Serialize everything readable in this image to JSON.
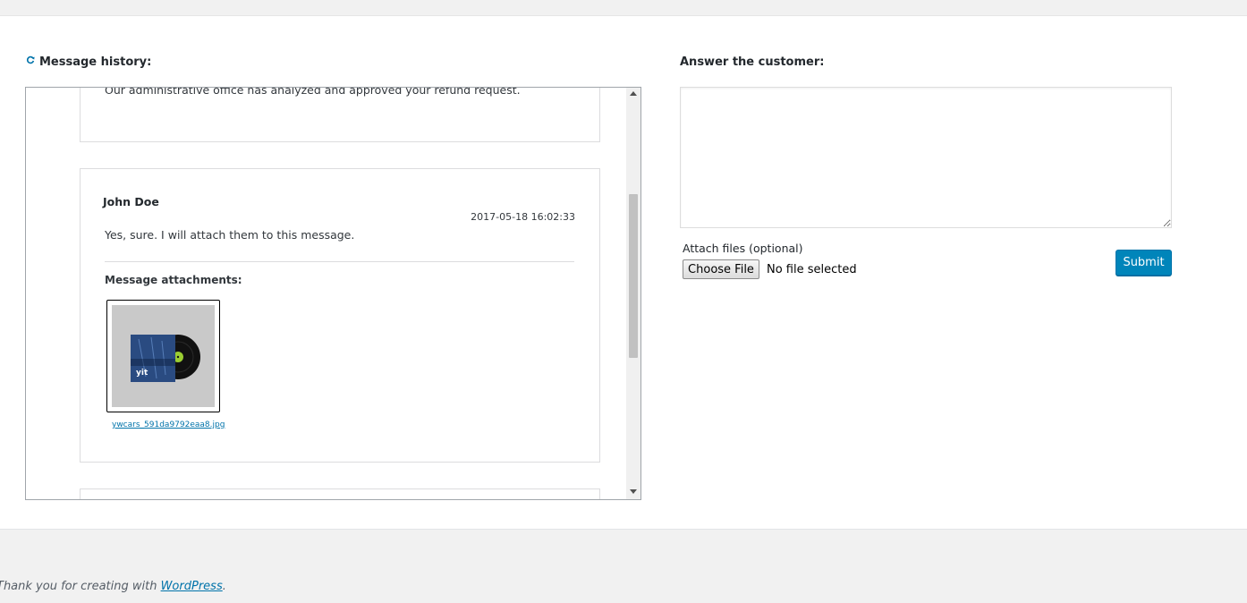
{
  "history": {
    "title": "Message history:",
    "messages": [
      {
        "body": "Our administrative office has analyzed and approved your refund request."
      },
      {
        "author": "John Doe",
        "date": "2017-05-18 16:02:33",
        "body": "Yes, sure. I will attach them to this message.",
        "attachments_label": "Message attachments:",
        "attachments": [
          {
            "filename": "ywcars_591da9792eaa8.jpg",
            "icon": "vinyl-record-image"
          }
        ]
      }
    ]
  },
  "answer": {
    "title": "Answer the customer:",
    "textarea_value": "",
    "attach_label": "Attach files (optional)",
    "choose_file_label": "Choose File",
    "no_file_text": "No file selected",
    "submit_label": "Submit"
  },
  "footer": {
    "text": "Thank you for creating with ",
    "link_text": "WordPress",
    "suffix": "."
  },
  "colors": {
    "accent": "#0085ba",
    "link": "#0073aa",
    "background": "#f1f1f1"
  }
}
